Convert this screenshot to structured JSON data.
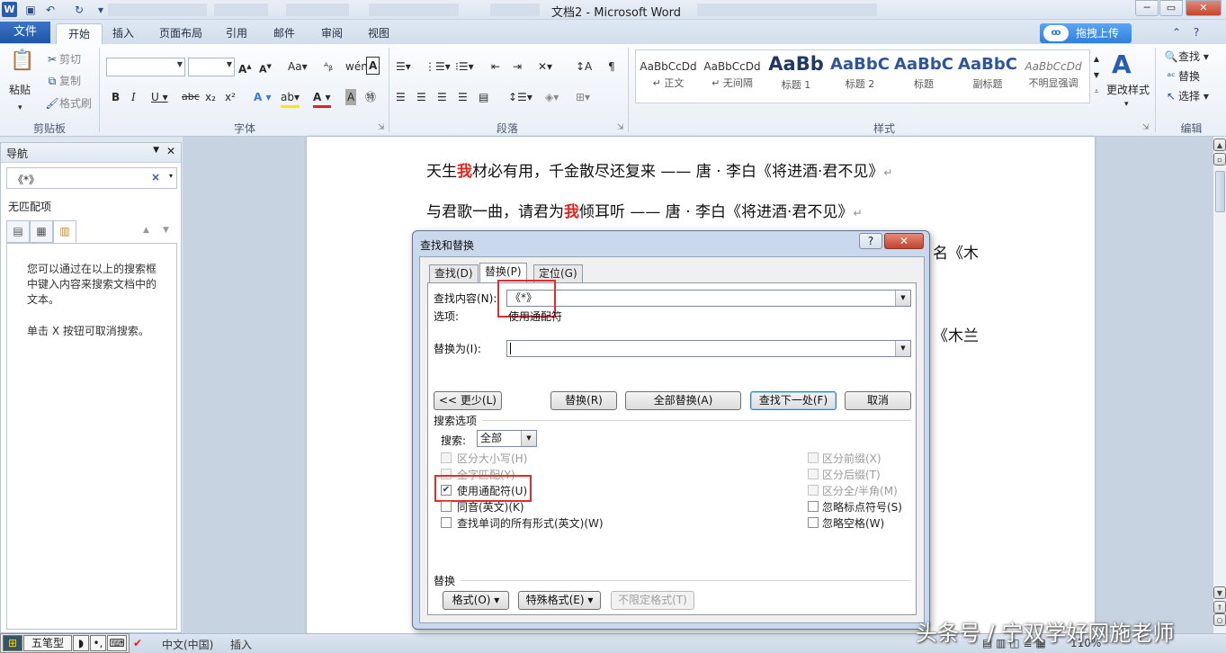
{
  "window": {
    "title": "文档2 - Microsoft Word"
  },
  "ribbon": {
    "tabs": [
      "文件",
      "开始",
      "插入",
      "页面布局",
      "引用",
      "邮件",
      "审阅",
      "视图"
    ],
    "active_tab": "开始",
    "upload_button": "拖拽上传",
    "clipboard": {
      "paste": "粘贴",
      "cut": "剪切",
      "copy": "复制",
      "format_painter": "格式刷",
      "label": "剪贴板"
    },
    "font": {
      "label": "字体"
    },
    "paragraph": {
      "label": "段落"
    },
    "styles": {
      "label": "样式",
      "items": [
        {
          "sample": "AaBbCcDd",
          "name": "↵ 正文"
        },
        {
          "sample": "AaBbCcDd",
          "name": "↵ 无间隔"
        },
        {
          "sample": "AaBb",
          "name": "标题 1"
        },
        {
          "sample": "AaBbC",
          "name": "标题 2"
        },
        {
          "sample": "AaBbC",
          "name": "标题"
        },
        {
          "sample": "AaBbC",
          "name": "副标题"
        },
        {
          "sample": "AaBbCcDd",
          "name": "不明显强调"
        }
      ],
      "change_styles": "更改样式"
    },
    "editing": {
      "label": "编辑",
      "find": "查找",
      "replace": "替换",
      "select": "选择"
    }
  },
  "nav_pane": {
    "title": "导航",
    "search_value": "《*》",
    "no_match": "无匹配项",
    "help_text_1": "您可以通过在以上的搜索框中键入内容来搜索文档中的文本。",
    "help_text_2": "单击 X 按钮可取消搜索。"
  },
  "document": {
    "line1": {
      "pre": "天生",
      "hl": "我",
      "post": "材必有用，千金散尽还复来 —— 唐 · 李白《将进酒·君不见》"
    },
    "line2": {
      "pre": "与君歌一曲，请君为",
      "hl": "我",
      "post": "倾耳听 —— 唐 · 李白《将进酒·君不见》"
    },
    "line3_tail": "名《木",
    "line4_tail": "《木兰"
  },
  "dialog": {
    "title": "查找和替换",
    "help": "?",
    "close": "✕",
    "tabs": [
      "查找(D)",
      "替换(P)",
      "定位(G)"
    ],
    "active_tab": "替换(P)",
    "find_label": "查找内容(N):",
    "find_value": "《*》",
    "options_label": "选项:",
    "options_value": "使用通配符",
    "replace_label": "替换为(I):",
    "replace_value": "",
    "buttons": {
      "less": "<< 更少(L)",
      "replace": "替换(R)",
      "replace_all": "全部替换(A)",
      "find_next": "查找下一处(F)",
      "cancel": "取消"
    },
    "search_options_title": "搜索选项",
    "search_label": "搜索:",
    "search_value": "全部",
    "left_options": [
      {
        "label": "区分大小写(H)",
        "checked": false,
        "enabled": false
      },
      {
        "label": "全字匹配(Y)",
        "checked": false,
        "enabled": false
      },
      {
        "label": "使用通配符(U)",
        "checked": true,
        "enabled": true
      },
      {
        "label": "同音(英文)(K)",
        "checked": false,
        "enabled": true
      },
      {
        "label": "查找单词的所有形式(英文)(W)",
        "checked": false,
        "enabled": true
      }
    ],
    "right_options": [
      {
        "label": "区分前缀(X)",
        "checked": false,
        "enabled": false
      },
      {
        "label": "区分后缀(T)",
        "checked": false,
        "enabled": false
      },
      {
        "label": "区分全/半角(M)",
        "checked": false,
        "enabled": false
      },
      {
        "label": "忽略标点符号(S)",
        "checked": false,
        "enabled": true
      },
      {
        "label": "忽略空格(W)",
        "checked": false,
        "enabled": true
      }
    ],
    "replace_section_title": "替换",
    "format_buttons": [
      "格式(O) ▾",
      "特殊格式(E) ▾",
      "不限定格式(T)"
    ]
  },
  "statusbar": {
    "ime_mode": "五笔型",
    "language": "中文(中国)",
    "insert_mode": "插入",
    "zoom": "110%"
  },
  "watermark": "头条号 / 宁双学好网施老师",
  "colors": {
    "accent": "#2a5db0",
    "highlight_red": "#e1241b",
    "annotation_red": "#e22b2b"
  }
}
